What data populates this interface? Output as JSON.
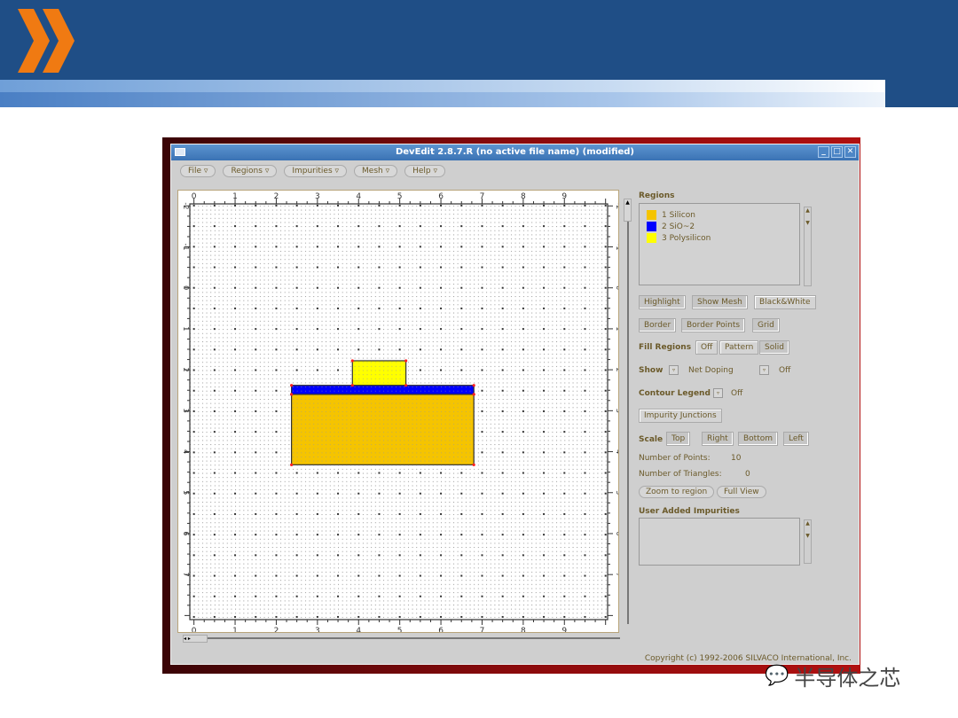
{
  "window": {
    "title": "DevEdit 2.8.7.R (no active file name) (modified)",
    "controls": [
      "_",
      "□",
      "✕"
    ]
  },
  "menubar": [
    {
      "label": "File"
    },
    {
      "label": "Regions"
    },
    {
      "label": "Impurities"
    },
    {
      "label": "Mesh"
    },
    {
      "label": "Help"
    }
  ],
  "canvas": {
    "x_ticks": [
      "0",
      "1",
      "2",
      "3",
      "4",
      "5",
      "6",
      "7",
      "8",
      "9"
    ],
    "y_ticks": [
      "-2",
      "-1",
      "0",
      "1",
      "2",
      "3",
      "4",
      "5",
      "6",
      "7"
    ],
    "x_range": [
      -0.1,
      10.05
    ],
    "y_range": [
      -2.05,
      8.1
    ],
    "regions": [
      {
        "name": "Silicon",
        "color": "#f5c400",
        "x": [
          2.37,
          6.8
        ],
        "y": [
          2.6,
          4.32
        ]
      },
      {
        "name": "SiO~2",
        "color": "#0000ff",
        "x": [
          2.37,
          6.8
        ],
        "y": [
          2.38,
          2.6
        ]
      },
      {
        "name": "Polysilicon",
        "color": "#ffff00",
        "x": [
          3.85,
          5.15
        ],
        "y": [
          1.78,
          2.38
        ]
      }
    ]
  },
  "panel": {
    "regions_title": "Regions",
    "regions": [
      {
        "label": "1 Silicon",
        "color": "#f5c400"
      },
      {
        "label": "2 SiO~2",
        "color": "#0000ff"
      },
      {
        "label": "3 Polysilicon",
        "color": "#ffff00"
      }
    ],
    "highlight": "Highlight",
    "show_mesh": "Show Mesh",
    "bw": "Black&White",
    "border": "Border",
    "border_points": "Border Points",
    "grid": "Grid",
    "fill_regions": "Fill Regions",
    "fill_off": "Off",
    "fill_pattern": "Pattern",
    "fill_solid": "Solid",
    "show": "Show",
    "show_value": "Net Doping",
    "show_value2": "Off",
    "contour_legend": "Contour Legend",
    "contour_value": "Off",
    "impurity_junctions": "Impurity Junctions",
    "scale": "Scale",
    "scale_top": "Top",
    "scale_right": "Right",
    "scale_bottom": "Bottom",
    "scale_left": "Left",
    "num_points_label": "Number of Points:",
    "num_points": "10",
    "num_triangles_label": "Number of Triangles:",
    "num_triangles": "0",
    "zoom_region": "Zoom to region",
    "full_view": "Full View",
    "user_impurities": "User Added Impurities",
    "copyright": "Copyright (c) 1992-2006 SILVACO International, Inc."
  },
  "watermark": "半导体之芯"
}
